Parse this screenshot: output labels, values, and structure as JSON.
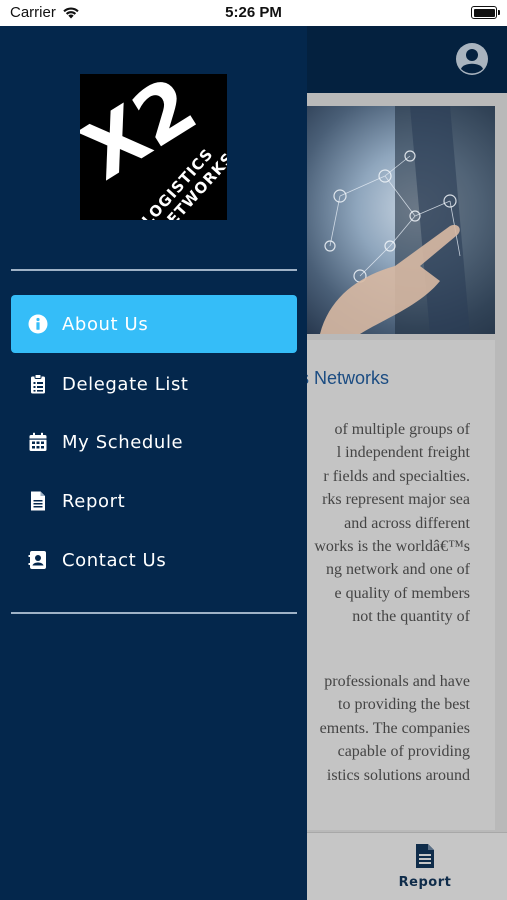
{
  "status_bar": {
    "carrier": "Carrier",
    "time": "5:26 PM"
  },
  "drawer": {
    "logo": {
      "mark": "X2",
      "line1": "LOGISTICS",
      "line2": "NETWORKS"
    },
    "menu": [
      {
        "label": "About Us",
        "icon": "info-icon",
        "active": true
      },
      {
        "label": "Delegate List",
        "icon": "clipboard-icon",
        "active": false
      },
      {
        "label": "My Schedule",
        "icon": "calendar-icon",
        "active": false
      },
      {
        "label": "Report",
        "icon": "document-icon",
        "active": false
      },
      {
        "label": "Contact Us",
        "icon": "contact-card-icon",
        "active": false
      }
    ]
  },
  "background": {
    "title": "s Networks",
    "paragraph1": [
      "of multiple groups of",
      "l independent freight",
      "r fields and specialties.",
      "rks represent major sea",
      "and across different",
      "works is the worldâ€™s",
      "ng network and one of",
      "e quality of members",
      "not the quantity of"
    ],
    "paragraph2": [
      "professionals and have",
      "to providing the best",
      "ements. The companies",
      "capable of providing",
      "istics solutions around"
    ],
    "tab": {
      "label": "Report",
      "icon": "document-icon"
    }
  },
  "colors": {
    "drawer": "#04274c",
    "active_item": "#35bdf8",
    "header": "#04213f",
    "divider": "#9fb2c6"
  }
}
